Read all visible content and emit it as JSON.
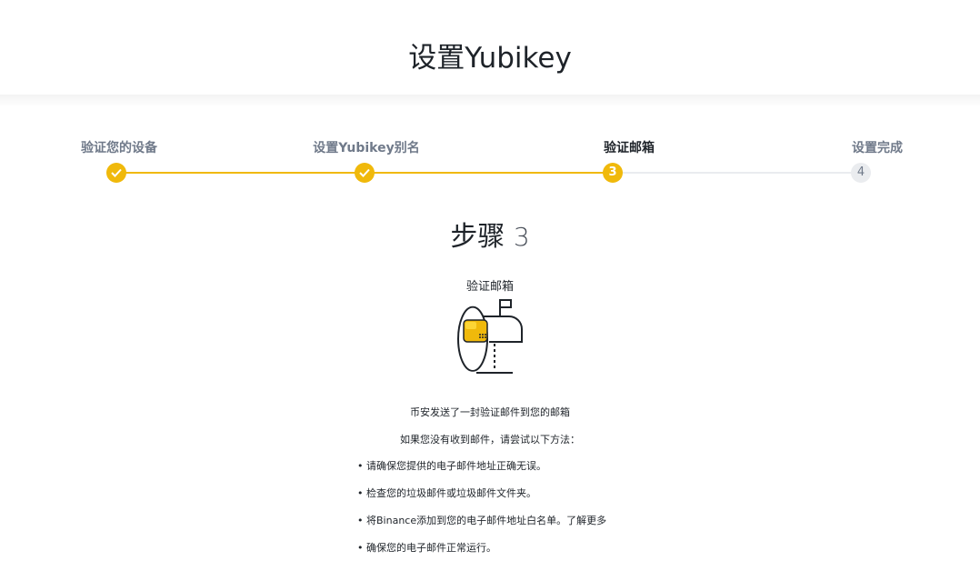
{
  "header": {
    "title": "设置Yubikey"
  },
  "stepper": {
    "steps": [
      {
        "label": "验证您的设备",
        "status": "done"
      },
      {
        "label": "设置Yubikey别名",
        "status": "done"
      },
      {
        "label": "验证邮箱",
        "number": "3",
        "status": "active"
      },
      {
        "label": "设置完成",
        "number": "4",
        "status": "pending"
      }
    ]
  },
  "content": {
    "step_word": "步骤",
    "step_number": "3",
    "subtitle": "验证邮箱",
    "icon": "mailbox-icon",
    "message_sent": "币安发送了一封验证邮件到您的邮箱",
    "message_if_not_received": "如果您没有收到邮件，请尝试以下方法：",
    "tips": [
      "请确保您提供的电子邮件地址正确无误。",
      "检查您的垃圾邮件或垃圾邮件文件夹。",
      "将Binance添加到您的电子邮件地址白名单。",
      "确保您的电子邮件正常运行。"
    ],
    "learn_more": "了解更多"
  },
  "colors": {
    "accent": "#f0b90b",
    "pending": "#eaecef",
    "text": "#1e2329",
    "muted": "#707a8a"
  }
}
